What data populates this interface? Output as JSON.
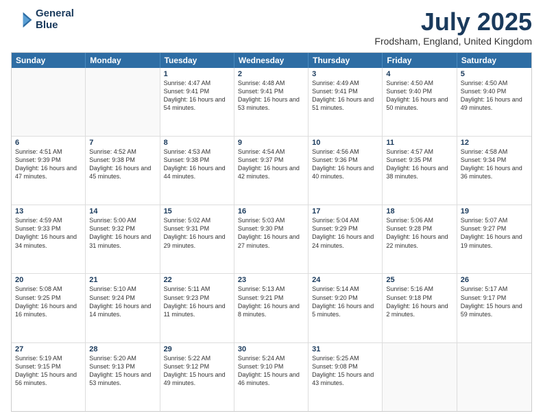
{
  "logo": {
    "line1": "General",
    "line2": "Blue"
  },
  "title": "July 2025",
  "subtitle": "Frodsham, England, United Kingdom",
  "days": [
    "Sunday",
    "Monday",
    "Tuesday",
    "Wednesday",
    "Thursday",
    "Friday",
    "Saturday"
  ],
  "weeks": [
    [
      {
        "day": null
      },
      {
        "day": null
      },
      {
        "day": "1",
        "rise": "4:47 AM",
        "set": "9:41 PM",
        "daylight": "16 hours and 54 minutes."
      },
      {
        "day": "2",
        "rise": "4:48 AM",
        "set": "9:41 PM",
        "daylight": "16 hours and 53 minutes."
      },
      {
        "day": "3",
        "rise": "4:49 AM",
        "set": "9:41 PM",
        "daylight": "16 hours and 51 minutes."
      },
      {
        "day": "4",
        "rise": "4:50 AM",
        "set": "9:40 PM",
        "daylight": "16 hours and 50 minutes."
      },
      {
        "day": "5",
        "rise": "4:50 AM",
        "set": "9:40 PM",
        "daylight": "16 hours and 49 minutes."
      }
    ],
    [
      {
        "day": "6",
        "rise": "4:51 AM",
        "set": "9:39 PM",
        "daylight": "16 hours and 47 minutes."
      },
      {
        "day": "7",
        "rise": "4:52 AM",
        "set": "9:38 PM",
        "daylight": "16 hours and 45 minutes."
      },
      {
        "day": "8",
        "rise": "4:53 AM",
        "set": "9:38 PM",
        "daylight": "16 hours and 44 minutes."
      },
      {
        "day": "9",
        "rise": "4:54 AM",
        "set": "9:37 PM",
        "daylight": "16 hours and 42 minutes."
      },
      {
        "day": "10",
        "rise": "4:56 AM",
        "set": "9:36 PM",
        "daylight": "16 hours and 40 minutes."
      },
      {
        "day": "11",
        "rise": "4:57 AM",
        "set": "9:35 PM",
        "daylight": "16 hours and 38 minutes."
      },
      {
        "day": "12",
        "rise": "4:58 AM",
        "set": "9:34 PM",
        "daylight": "16 hours and 36 minutes."
      }
    ],
    [
      {
        "day": "13",
        "rise": "4:59 AM",
        "set": "9:33 PM",
        "daylight": "16 hours and 34 minutes."
      },
      {
        "day": "14",
        "rise": "5:00 AM",
        "set": "9:32 PM",
        "daylight": "16 hours and 31 minutes."
      },
      {
        "day": "15",
        "rise": "5:02 AM",
        "set": "9:31 PM",
        "daylight": "16 hours and 29 minutes."
      },
      {
        "day": "16",
        "rise": "5:03 AM",
        "set": "9:30 PM",
        "daylight": "16 hours and 27 minutes."
      },
      {
        "day": "17",
        "rise": "5:04 AM",
        "set": "9:29 PM",
        "daylight": "16 hours and 24 minutes."
      },
      {
        "day": "18",
        "rise": "5:06 AM",
        "set": "9:28 PM",
        "daylight": "16 hours and 22 minutes."
      },
      {
        "day": "19",
        "rise": "5:07 AM",
        "set": "9:27 PM",
        "daylight": "16 hours and 19 minutes."
      }
    ],
    [
      {
        "day": "20",
        "rise": "5:08 AM",
        "set": "9:25 PM",
        "daylight": "16 hours and 16 minutes."
      },
      {
        "day": "21",
        "rise": "5:10 AM",
        "set": "9:24 PM",
        "daylight": "16 hours and 14 minutes."
      },
      {
        "day": "22",
        "rise": "5:11 AM",
        "set": "9:23 PM",
        "daylight": "16 hours and 11 minutes."
      },
      {
        "day": "23",
        "rise": "5:13 AM",
        "set": "9:21 PM",
        "daylight": "16 hours and 8 minutes."
      },
      {
        "day": "24",
        "rise": "5:14 AM",
        "set": "9:20 PM",
        "daylight": "16 hours and 5 minutes."
      },
      {
        "day": "25",
        "rise": "5:16 AM",
        "set": "9:18 PM",
        "daylight": "16 hours and 2 minutes."
      },
      {
        "day": "26",
        "rise": "5:17 AM",
        "set": "9:17 PM",
        "daylight": "15 hours and 59 minutes."
      }
    ],
    [
      {
        "day": "27",
        "rise": "5:19 AM",
        "set": "9:15 PM",
        "daylight": "15 hours and 56 minutes."
      },
      {
        "day": "28",
        "rise": "5:20 AM",
        "set": "9:13 PM",
        "daylight": "15 hours and 53 minutes."
      },
      {
        "day": "29",
        "rise": "5:22 AM",
        "set": "9:12 PM",
        "daylight": "15 hours and 49 minutes."
      },
      {
        "day": "30",
        "rise": "5:24 AM",
        "set": "9:10 PM",
        "daylight": "15 hours and 46 minutes."
      },
      {
        "day": "31",
        "rise": "5:25 AM",
        "set": "9:08 PM",
        "daylight": "15 hours and 43 minutes."
      },
      {
        "day": null
      },
      {
        "day": null
      }
    ]
  ],
  "labels": {
    "sunrise_prefix": "Sunrise: ",
    "sunset_prefix": "Sunset: ",
    "daylight_prefix": "Daylight: "
  }
}
